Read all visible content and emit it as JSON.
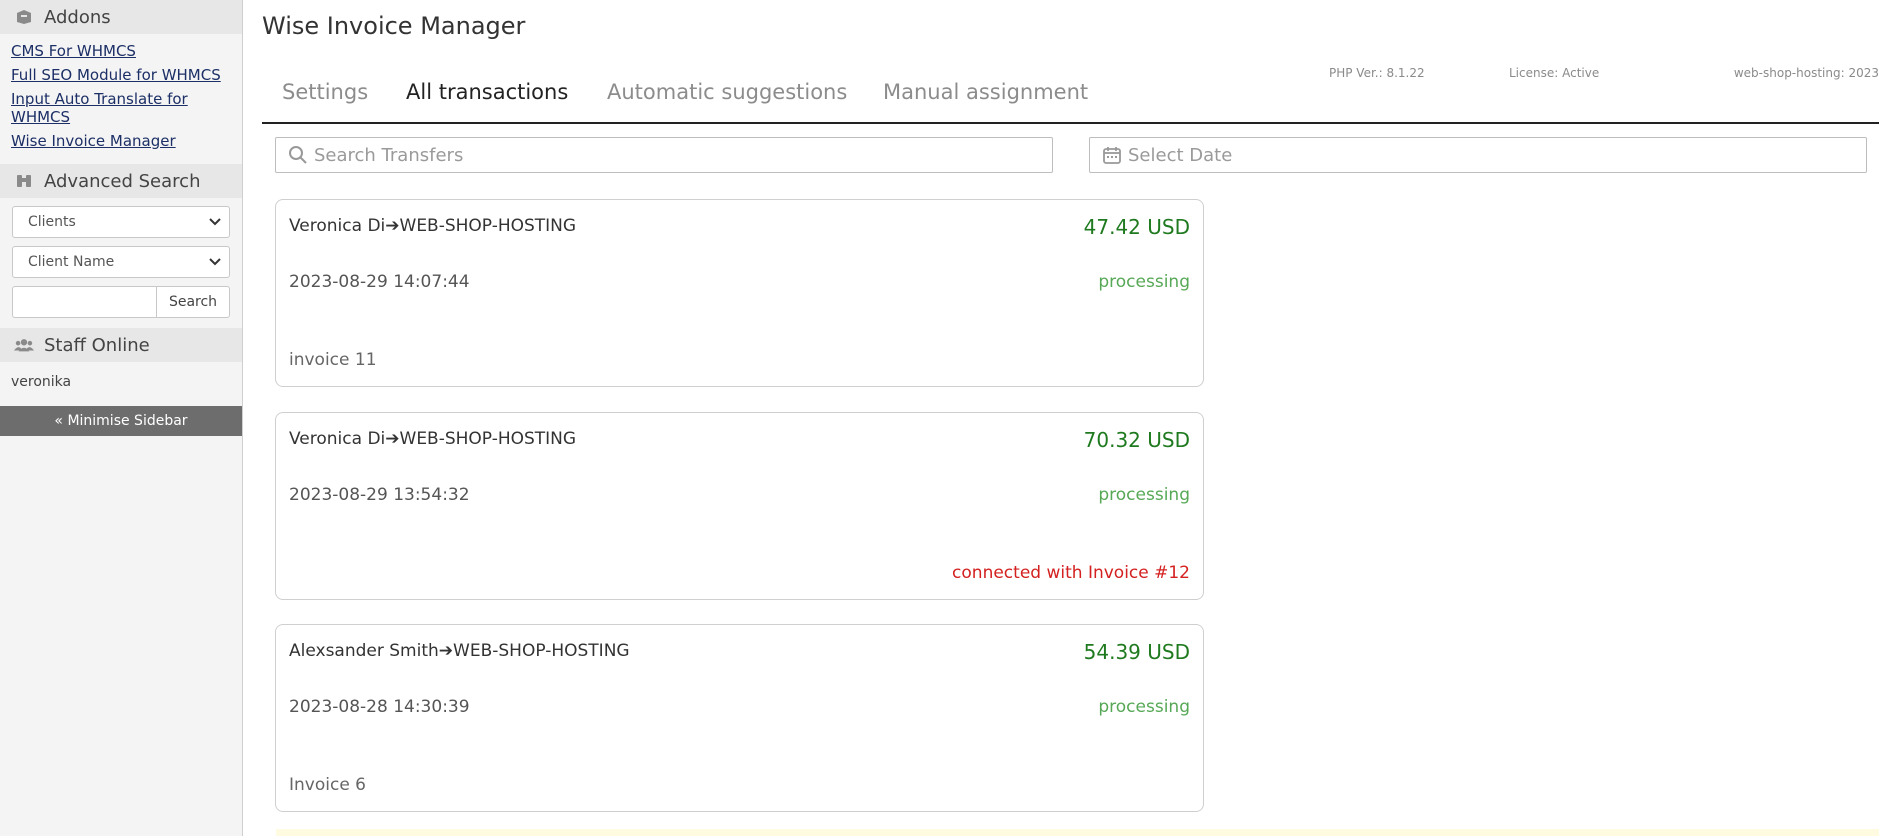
{
  "sidebar": {
    "addons": {
      "title": "Addons",
      "links": [
        "CMS For WHMCS",
        "Full SEO Module for WHMCS",
        "Input Auto Translate for WHMCS",
        "Wise Invoice Manager"
      ]
    },
    "advanced_search": {
      "title": "Advanced Search",
      "select1": "Clients",
      "select2": "Client Name",
      "input_value": "",
      "button": "Search"
    },
    "staff_online": {
      "title": "Staff Online",
      "users": [
        "veronika"
      ]
    },
    "minimise": "« Minimise Sidebar"
  },
  "page": {
    "title": "Wise Invoice Manager",
    "meta": {
      "php": "PHP Ver.: 8.1.22",
      "license": "License: Active",
      "host": "web-shop-hosting: 2023"
    },
    "tabs": [
      "Settings",
      "All transactions",
      "Automatic suggestions",
      "Manual assignment"
    ],
    "active_tab": 1,
    "search_placeholder": "Search Transfers",
    "date_placeholder": "Select Date"
  },
  "transactions": [
    {
      "parties": "Veronica Di➔WEB-SHOP-HOSTING",
      "amount": "47.42 USD",
      "date": "2023-08-29 14:07:44",
      "status": "processing",
      "note_left": "invoice 11",
      "note_right": ""
    },
    {
      "parties": "Veronica Di➔WEB-SHOP-HOSTING",
      "amount": "70.32 USD",
      "date": "2023-08-29 13:54:32",
      "status": "processing",
      "note_left": "",
      "note_right": "connected with Invoice #12"
    },
    {
      "parties": "Alexsander Smith➔WEB-SHOP-HOSTING",
      "amount": "54.39 USD",
      "date": "2023-08-28 14:30:39",
      "status": "processing",
      "note_left": "Invoice 6",
      "note_right": ""
    }
  ]
}
